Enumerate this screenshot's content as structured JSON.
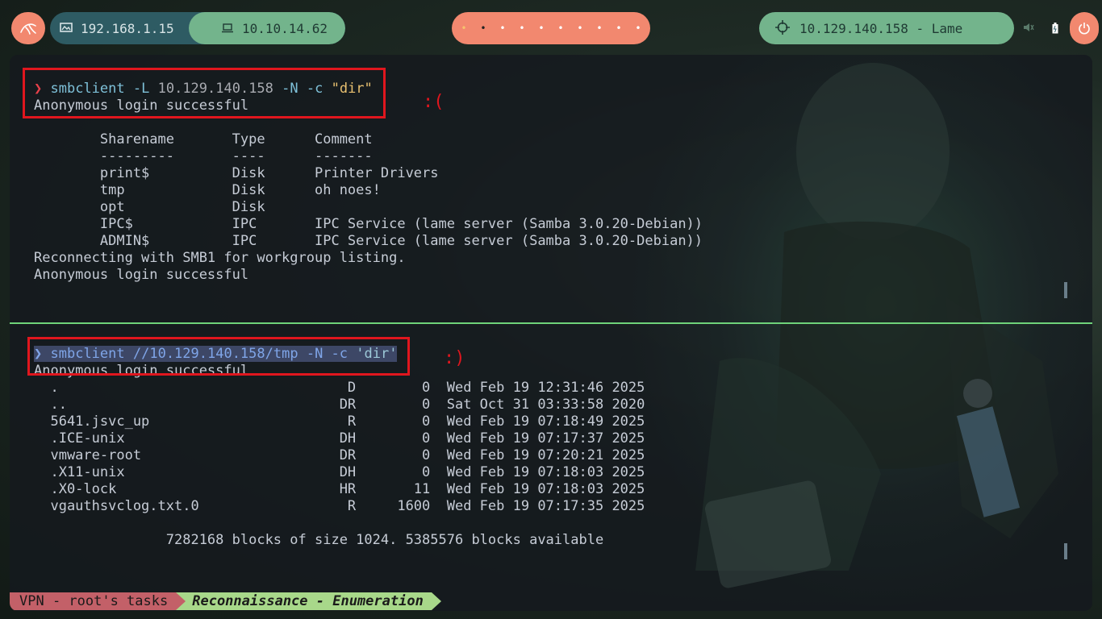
{
  "topbar": {
    "workspace_1": "192.168.1.15",
    "workspace_2": "10.10.14.62",
    "workspace_dots": [
      "•",
      "•",
      "•",
      "•",
      "•",
      "•",
      "•",
      "•",
      "•",
      "•"
    ],
    "target": "10.129.140.158 - Lame"
  },
  "terminal": {
    "pane1": {
      "prompt": "❯",
      "cmd_name": "smbclient",
      "cmd_flag1": "-L",
      "cmd_ip": "10.129.140.158",
      "cmd_flags2": "-N -c",
      "cmd_str": "\"dir\"",
      "anon_login": "Anonymous login successful",
      "smiley": ":(",
      "table_header": "        Sharename       Type      Comment",
      "table_sep": "        ---------       ----      -------",
      "rows": [
        "        print$          Disk      Printer Drivers",
        "        tmp             Disk      oh noes!",
        "        opt             Disk",
        "        IPC$            IPC       IPC Service (lame server (Samba 3.0.20-Debian))",
        "        ADMIN$          IPC       IPC Service (lame server (Samba 3.0.20-Debian))"
      ],
      "reconnect": "Reconnecting with SMB1 for workgroup listing.",
      "anon_login_2": "Anonymous login successful"
    },
    "pane2": {
      "prompt": "❯",
      "cmd_name": "smbclient",
      "cmd_path": "//10.129.140.158/tmp",
      "cmd_flags": "-N -c",
      "cmd_str": "'dir'",
      "anon_login": "Anonymous login successful",
      "smiley": ":)",
      "files": [
        "  .                                   D        0  Wed Feb 19 12:31:46 2025",
        "  ..                                 DR        0  Sat Oct 31 03:33:58 2020",
        "  5641.jsvc_up                        R        0  Wed Feb 19 07:18:49 2025",
        "  .ICE-unix                          DH        0  Wed Feb 19 07:17:37 2025",
        "  vmware-root                        DR        0  Wed Feb 19 07:20:21 2025",
        "  .X11-unix                          DH        0  Wed Feb 19 07:18:03 2025",
        "  .X0-lock                           HR       11  Wed Feb 19 07:18:03 2025",
        "  vgauthsvclog.txt.0                  R     1600  Wed Feb 19 07:17:35 2025"
      ],
      "blocks": "                7282168 blocks of size 1024. 5385576 blocks available"
    }
  },
  "status": {
    "session": "VPN - root's tasks",
    "window": "Reconnaissance - Enumeration"
  },
  "colors": {
    "accent_orange": "#f2886f",
    "accent_green": "#73b48c",
    "annotation_red": "#e0161e",
    "divider_green": "#6fd37a"
  },
  "icons": [
    "kali-dragon-icon",
    "monitor-icon",
    "laptop-icon",
    "crosshair-icon",
    "volume-icon",
    "battery-icon",
    "power-icon"
  ]
}
